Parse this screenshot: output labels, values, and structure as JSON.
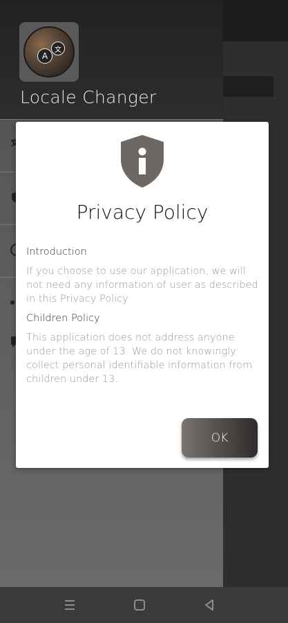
{
  "drawer": {
    "app_name": "Locale Changer",
    "items": [
      {
        "icon": "translate-icon"
      },
      {
        "icon": "shield-icon"
      },
      {
        "icon": "info-icon"
      },
      {
        "icon": "share-icon"
      },
      {
        "icon": "feedback-icon"
      }
    ]
  },
  "dialog": {
    "icon": "shield-info-icon",
    "title": "Privacy Policy",
    "sections": [
      {
        "heading": "Introduction",
        "body": "If you choose to use our application, we will not need any information of user as described in this Privacy Policy"
      },
      {
        "heading": "Children Policy",
        "body": "This application does not address anyone under the age of 13. We do not knowingly collect personal identifiable information from children under 13."
      }
    ],
    "ok_label": "OK"
  },
  "navbar": {
    "buttons": [
      "menu-icon",
      "home-icon",
      "back-icon"
    ]
  },
  "colors": {
    "dialog_bg": "#ffffff",
    "shield": "#6e6864",
    "button_start": "#7a7470",
    "button_end": "#2e2c2b"
  }
}
